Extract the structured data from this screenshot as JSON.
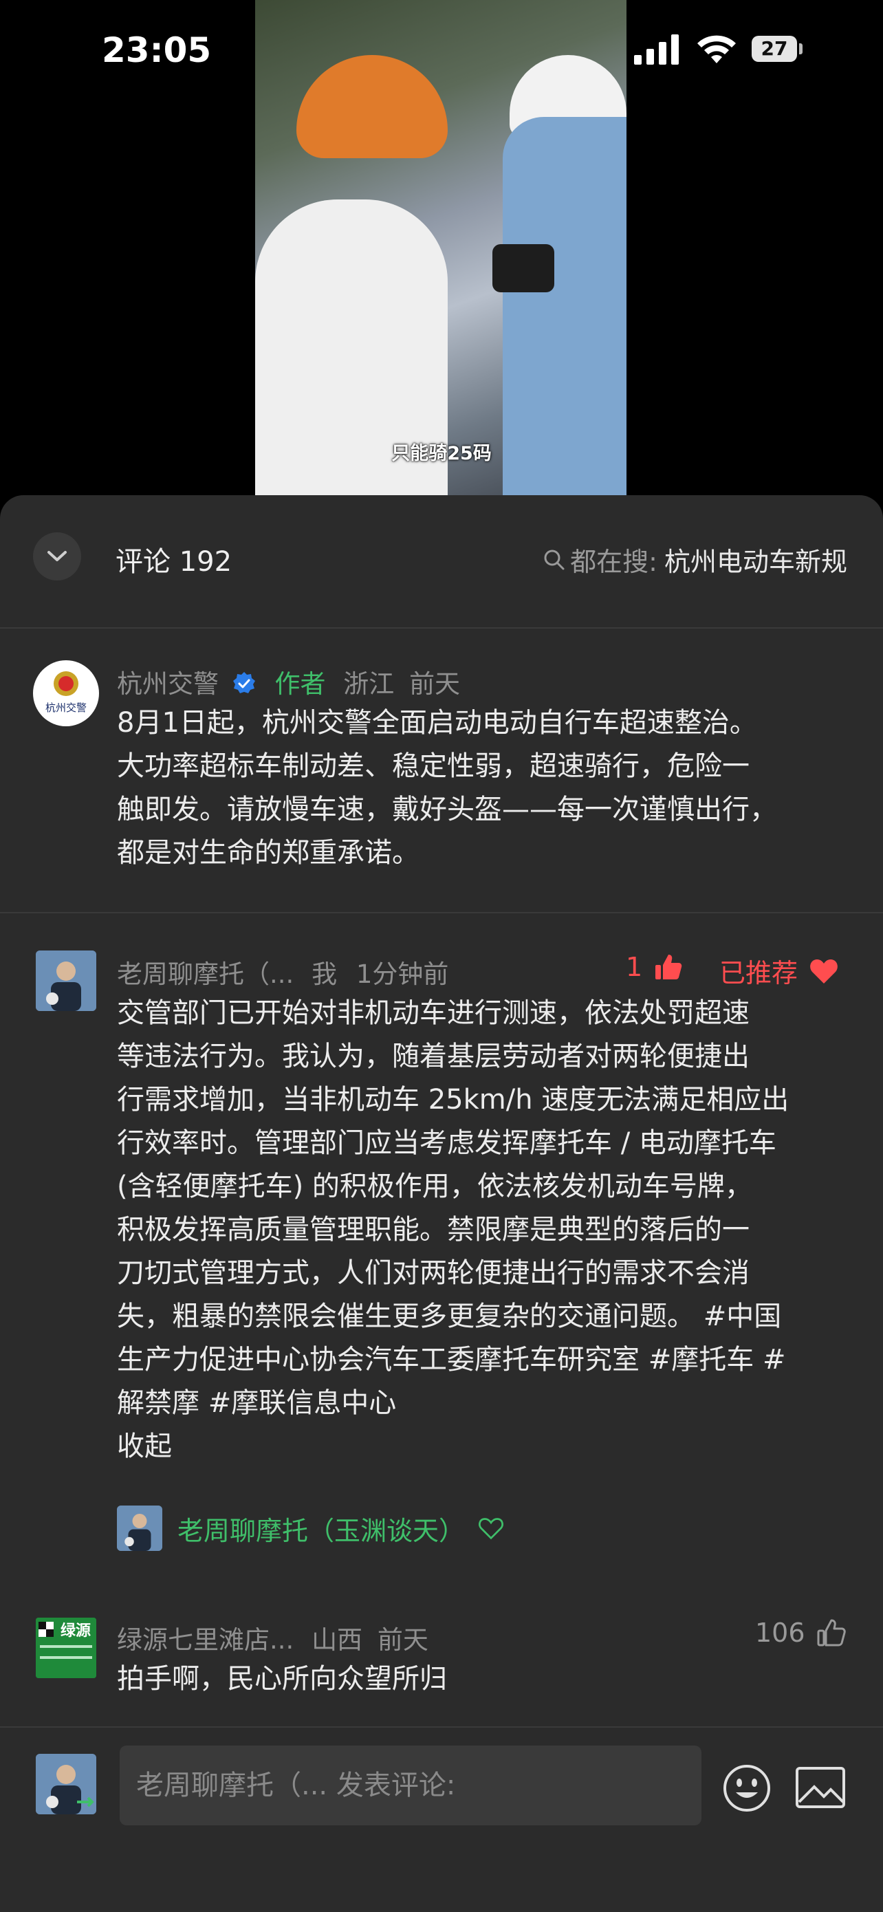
{
  "status_bar": {
    "time": "23:05",
    "battery": "27"
  },
  "video": {
    "caption": "只能骑25码"
  },
  "header": {
    "comment_label": "评论 192",
    "search_prefix": "都在搜:",
    "search_term": "杭州电动车新规"
  },
  "comments": [
    {
      "avatar_text": "杭州交警",
      "user": "杭州交警",
      "author_tag": "作者",
      "location": "浙江",
      "time": "前天",
      "lines": [
        "8月1日起，杭州交警全面启动电动自行车超速整治。",
        "大功率超标车制动差、稳定性弱，超速骑行，危险一",
        "触即发。请放慢车速，戴好头盔——每一次谨慎出行，",
        "都是对生命的郑重承诺。"
      ]
    },
    {
      "user": "老周聊摩托（...",
      "me_tag": "我",
      "time": "1分钟前",
      "like_count": "1",
      "recommended": "已推荐",
      "lines": [
        "交管部门已开始对非机动车进行测速，依法处罚超速",
        "等违法行为。我认为，随着基层劳动者对两轮便捷出",
        "行需求增加，当非机动车 25km/h 速度无法满足相应出",
        "行效率时。管理部门应当考虑发挥摩托车 / 电动摩托车",
        "(含轻便摩托车) 的积极作用，依法核发机动车号牌，",
        "积极发挥高质量管理职能。禁限摩是典型的落后的一",
        "刀切式管理方式，人们对两轮便捷出行的需求不会消",
        "失，粗暴的禁限会催生更多更复杂的交通问题。 #中国",
        "生产力促进中心协会汽车工委摩托车研究室 #摩托车 #",
        "解禁摩 #摩联信息中心"
      ],
      "collapse": "收起",
      "reply_user": "老周聊摩托（玉渊谈天）"
    },
    {
      "avatar_text": "绿源",
      "user": "绿源七里滩店...",
      "location": "山西",
      "time": "前天",
      "like_count": "106",
      "lines": [
        "拍手啊，民心所向众望所归"
      ]
    }
  ],
  "input": {
    "placeholder": "老周聊摩托（... 发表评论:"
  },
  "colors": {
    "accent_green": "#3fbf6a",
    "like_red": "#ff4d4f",
    "panel_bg": "#2b2b2b"
  }
}
